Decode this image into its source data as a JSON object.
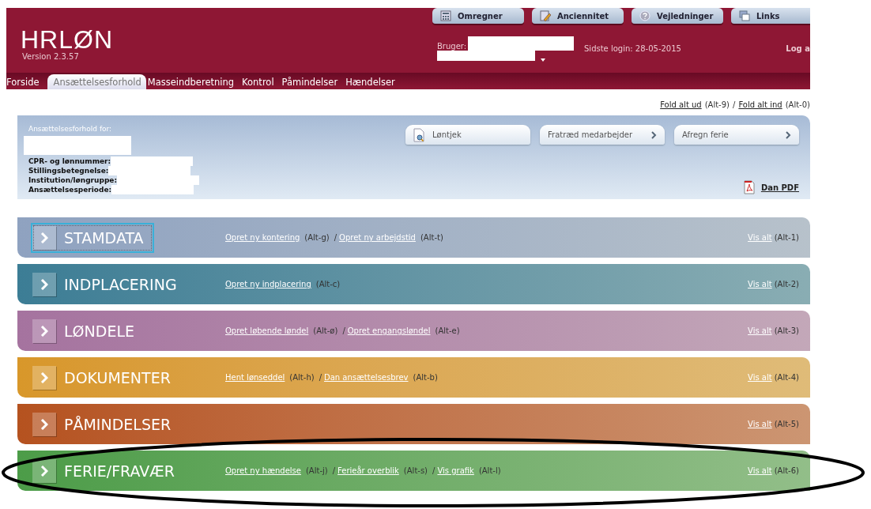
{
  "header": {
    "logo": "**HR**LØN",
    "version": "Version 2.3.57",
    "user_label": "Bruger:",
    "last_login": "Sidste login: 28-05-2015",
    "logout": "Log a",
    "tools": [
      {
        "label": "Omregner",
        "kind": "calculator"
      },
      {
        "label": "Anciennitet",
        "kind": "pencil"
      },
      {
        "label": "Vejledninger",
        "kind": "help"
      },
      {
        "label": "Links",
        "kind": "windows"
      }
    ]
  },
  "nav": [
    {
      "label": "Forside",
      "selected": false
    },
    {
      "label": "Ansættelsesforhold",
      "selected": true
    },
    {
      "label": "Masseindberetning",
      "selected": false
    },
    {
      "label": "Kontrol",
      "selected": false
    },
    {
      "label": "Påmindelser",
      "selected": false
    },
    {
      "label": "Hændelser",
      "selected": false
    }
  ],
  "fold": {
    "expand": "Fold alt ud",
    "expand_shortcut": "(Alt-9)",
    "separator": "/",
    "collapse": "Fold alt ind",
    "collapse_shortcut": "(Alt-0)"
  },
  "info": {
    "heading": "Ansættelsesforhold for:",
    "fields": [
      "CPR- og lønnummer:",
      "Stillingsbetegnelse:",
      "Institution/løngruppe:",
      "Ansættelsesperiode:"
    ],
    "actions": [
      {
        "label": "Løntjek",
        "kind": "icon"
      },
      {
        "label": "Fratræd medarbejder",
        "kind": "chevron"
      },
      {
        "label": "Afregn ferie",
        "kind": "chevron"
      }
    ],
    "pdf": "Dan PDF"
  },
  "sections": [
    {
      "title": "STAMDATA",
      "color": "#8fa2c0",
      "focused": true,
      "links": [
        {
          "text": "Opret ny kontering",
          "shortcut": "(Alt-g)"
        },
        {
          "separator": "/",
          "text": "Opret ny arbejdstid",
          "shortcut": "(Alt-t)"
        }
      ],
      "view_all": "Vis alt",
      "view_all_shortcut": "(Alt-1)"
    },
    {
      "title": "INDPLACERING",
      "color": "#3c7d95",
      "focused": false,
      "links": [
        {
          "text": "Opret ny indplacering",
          "shortcut": "(Alt-c)"
        }
      ],
      "view_all": "Vis alt",
      "view_all_shortcut": "(Alt-2)"
    },
    {
      "title": "LØNDELE",
      "color": "#a5739f",
      "focused": false,
      "links": [
        {
          "text": "Opret løbende løndel",
          "shortcut": "(Alt-ø)"
        },
        {
          "separator": "/",
          "text": "Opret engangsløndel",
          "shortcut": "(Alt-e)"
        }
      ],
      "view_all": "Vis alt",
      "view_all_shortcut": "(Alt-3)"
    },
    {
      "title": "DOKUMENTER",
      "color": "#d8972a",
      "focused": false,
      "links": [
        {
          "text": "Hent lønseddel",
          "shortcut": "(Alt-h)"
        },
        {
          "separator": "/",
          "text": "Dan ansættelsesbrev",
          "shortcut": "(Alt-b)"
        }
      ],
      "view_all": "Vis alt",
      "view_all_shortcut": "(Alt-4)"
    },
    {
      "title": "PÅMINDELSER",
      "color": "#b5521f",
      "focused": false,
      "view_all": "Vis alt",
      "view_all_shortcut": "(Alt-5)"
    },
    {
      "title": "FERIE/FRAVÆR",
      "color": "#4c9c48",
      "focused": false,
      "links": [
        {
          "text": "Opret ny hændelse",
          "shortcut": "(Alt-j)"
        },
        {
          "separator": "/",
          "text": "Ferieår overblik",
          "shortcut": "(Alt-s)"
        },
        {
          "separator": "/",
          "text": "Vis grafik",
          "shortcut": "(Alt-l)"
        }
      ],
      "view_all": "Vis alt",
      "view_all_shortcut": "(Alt-6)"
    }
  ]
}
